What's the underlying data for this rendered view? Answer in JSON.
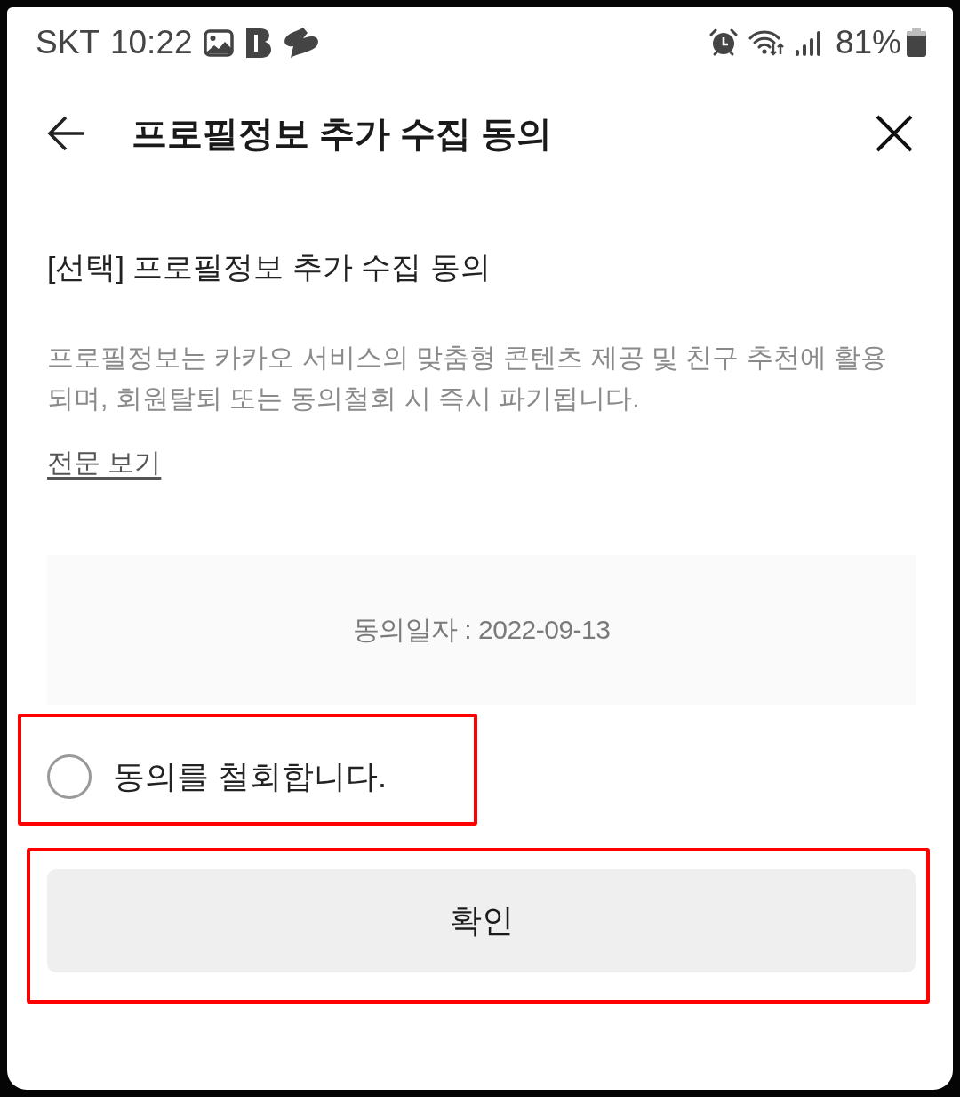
{
  "status_bar": {
    "carrier": "SKT",
    "time": "10:22",
    "battery": "81%"
  },
  "header": {
    "title": "프로필정보 추가 수집 동의"
  },
  "content": {
    "section_title": "[선택] 프로필정보 추가 수집 동의",
    "description": "프로필정보는 카카오 서비스의 맞춤형 콘텐츠 제공 및 친구 추천에 활용되며, 회원탈퇴 또는 동의철회 시 즉시 파기됩니다.",
    "full_text_link": "전문 보기",
    "consent_date": "동의일자 : 2022-09-13"
  },
  "withdraw_option": {
    "label": "동의를 철회합니다.",
    "checked": false,
    "highlighted": true
  },
  "confirm_button": {
    "label": "확인",
    "highlighted": true
  }
}
